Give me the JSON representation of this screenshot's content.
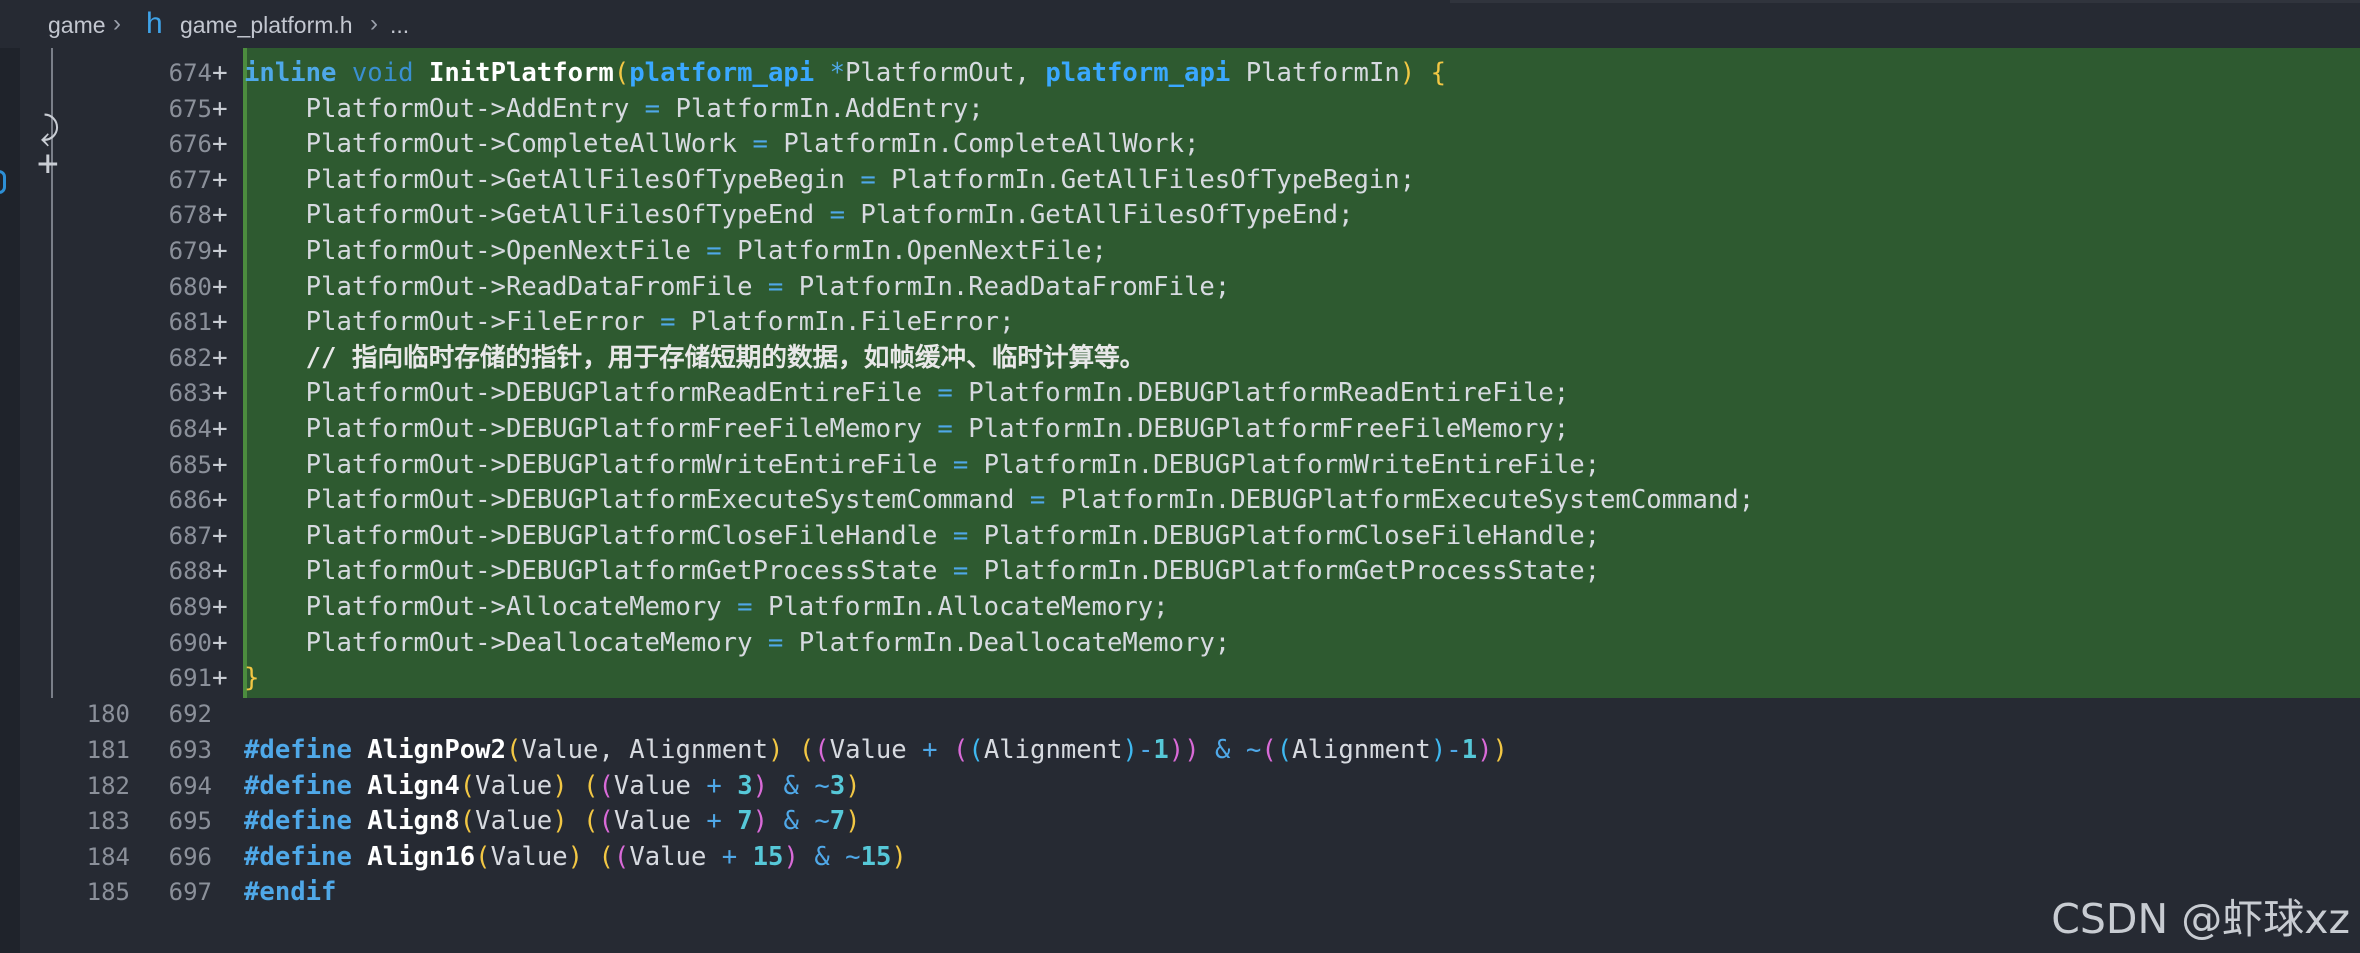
{
  "breadcrumb": {
    "folder": "game",
    "file_icon": "h",
    "file": "game_platform.h",
    "more": "..."
  },
  "gutter": {
    "undo_icon": "revert-icon",
    "add_icon": "add-icon"
  },
  "lines": [
    {
      "old": "",
      "new": "674",
      "plus": "+",
      "added": true,
      "key": "l674"
    },
    {
      "old": "",
      "new": "675",
      "plus": "+",
      "added": true,
      "key": "l675",
      "lhs": "PlatformOut->AddEntry",
      "rhs": "PlatformIn.AddEntry;"
    },
    {
      "old": "",
      "new": "676",
      "plus": "+",
      "added": true,
      "key": "l676",
      "lhs": "PlatformOut->CompleteAllWork",
      "rhs": "PlatformIn.CompleteAllWork;"
    },
    {
      "old": "",
      "new": "677",
      "plus": "+",
      "added": true,
      "key": "l677",
      "lhs": "PlatformOut->GetAllFilesOfTypeBegin",
      "rhs": "PlatformIn.GetAllFilesOfTypeBegin;"
    },
    {
      "old": "",
      "new": "678",
      "plus": "+",
      "added": true,
      "key": "l678",
      "lhs": "PlatformOut->GetAllFilesOfTypeEnd",
      "rhs": "PlatformIn.GetAllFilesOfTypeEnd;"
    },
    {
      "old": "",
      "new": "679",
      "plus": "+",
      "added": true,
      "key": "l679",
      "lhs": "PlatformOut->OpenNextFile",
      "rhs": "PlatformIn.OpenNextFile;"
    },
    {
      "old": "",
      "new": "680",
      "plus": "+",
      "added": true,
      "key": "l680",
      "lhs": "PlatformOut->ReadDataFromFile",
      "rhs": "PlatformIn.ReadDataFromFile;"
    },
    {
      "old": "",
      "new": "681",
      "plus": "+",
      "added": true,
      "key": "l681",
      "lhs": "PlatformOut->FileError",
      "rhs": "PlatformIn.FileError;"
    },
    {
      "old": "",
      "new": "682",
      "plus": "+",
      "added": true,
      "key": "l682",
      "comment": "// 指向临时存储的指针，用于存储短期的数据，如帧缓冲、临时计算等。"
    },
    {
      "old": "",
      "new": "683",
      "plus": "+",
      "added": true,
      "key": "l683",
      "lhs": "PlatformOut->DEBUGPlatformReadEntireFile",
      "rhs": "PlatformIn.DEBUGPlatformReadEntireFile;"
    },
    {
      "old": "",
      "new": "684",
      "plus": "+",
      "added": true,
      "key": "l684",
      "lhs": "PlatformOut->DEBUGPlatformFreeFileMemory",
      "rhs": "PlatformIn.DEBUGPlatformFreeFileMemory;"
    },
    {
      "old": "",
      "new": "685",
      "plus": "+",
      "added": true,
      "key": "l685",
      "lhs": "PlatformOut->DEBUGPlatformWriteEntireFile",
      "rhs": "PlatformIn.DEBUGPlatformWriteEntireFile;"
    },
    {
      "old": "",
      "new": "686",
      "plus": "+",
      "added": true,
      "key": "l686",
      "lhs": "PlatformOut->DEBUGPlatformExecuteSystemCommand",
      "rhs": "PlatformIn.DEBUGPlatformExecuteSystemCommand;"
    },
    {
      "old": "",
      "new": "687",
      "plus": "+",
      "added": true,
      "key": "l687",
      "lhs": "PlatformOut->DEBUGPlatformCloseFileHandle",
      "rhs": "PlatformIn.DEBUGPlatformCloseFileHandle;"
    },
    {
      "old": "",
      "new": "688",
      "plus": "+",
      "added": true,
      "key": "l688",
      "lhs": "PlatformOut->DEBUGPlatformGetProcessState",
      "rhs": "PlatformIn.DEBUGPlatformGetProcessState;"
    },
    {
      "old": "",
      "new": "689",
      "plus": "+",
      "added": true,
      "key": "l689",
      "lhs": "PlatformOut->AllocateMemory",
      "rhs": "PlatformIn.AllocateMemory;"
    },
    {
      "old": "",
      "new": "690",
      "plus": "+",
      "added": true,
      "key": "l690",
      "lhs": "PlatformOut->DeallocateMemory",
      "rhs": "PlatformIn.DeallocateMemory;"
    },
    {
      "old": "",
      "new": "691",
      "plus": "+",
      "added": true,
      "key": "l691"
    },
    {
      "old": "180",
      "new": "692",
      "plus": "",
      "added": false,
      "key": "l692"
    },
    {
      "old": "181",
      "new": "693",
      "plus": "",
      "added": false,
      "key": "l693"
    },
    {
      "old": "182",
      "new": "694",
      "plus": "",
      "added": false,
      "key": "l694"
    },
    {
      "old": "183",
      "new": "695",
      "plus": "",
      "added": false,
      "key": "l695"
    },
    {
      "old": "184",
      "new": "696",
      "plus": "",
      "added": false,
      "key": "l696"
    },
    {
      "old": "185",
      "new": "697",
      "plus": "",
      "added": false,
      "key": "l697"
    }
  ],
  "tokens": {
    "inline": "inline",
    "void": "void",
    "InitPlatform": "InitPlatform",
    "platform_api": "platform_api",
    "star": "*",
    "PlatformOut": "PlatformOut",
    "PlatformIn": "PlatformIn",
    "comma": ",",
    "eq": "=",
    "lparen": "(",
    "rparen": ")",
    "lbrace": "{",
    "rbrace": "}",
    "define": "#define",
    "endif": "#endif",
    "AlignPow2": "AlignPow2",
    "Align4": "Align4",
    "Align8": "Align8",
    "Align16": "Align16",
    "Value": "Value",
    "Alignment": "Alignment",
    "plus": "+",
    "minus": "-",
    "amp": "&",
    "tilde": "~",
    "n1": "1",
    "n3": "3",
    "n7": "7",
    "n15": "15"
  },
  "watermark": "CSDN @虾球xz",
  "colors": {
    "added_bg": "#2e5a30",
    "editor_bg": "#262a33",
    "keyword": "#4fa8e8",
    "number": "#56c8d8",
    "paren_gold": "#f2c744",
    "paren_pink": "#d96ad8"
  }
}
